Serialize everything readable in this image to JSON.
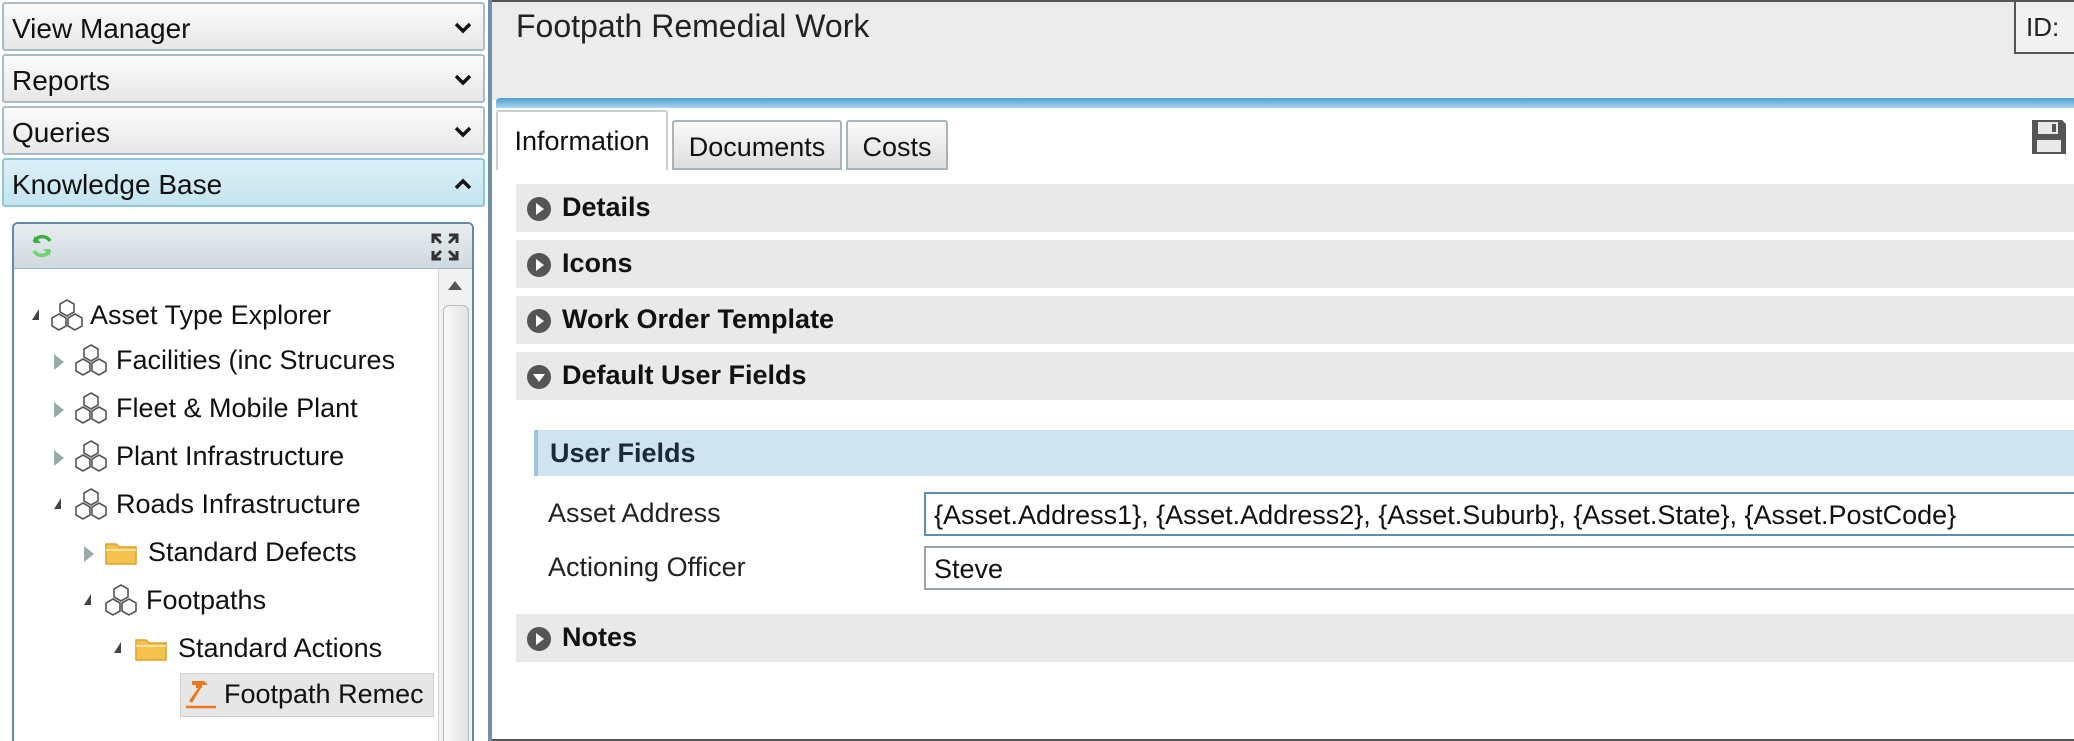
{
  "sidebar": {
    "accordion": {
      "view_manager": "View Manager",
      "reports": "Reports",
      "queries": "Queries",
      "knowledge_base": "Knowledge Base"
    },
    "tree": {
      "items": [
        {
          "label": "Asset Type Explorer",
          "icon": "cubes-icon",
          "state": "expanded"
        },
        {
          "label": "Facilities (inc Strucures",
          "icon": "cubes-icon",
          "state": "collapsed"
        },
        {
          "label": "Fleet & Mobile Plant",
          "icon": "cubes-icon",
          "state": "collapsed"
        },
        {
          "label": "Plant Infrastructure",
          "icon": "cubes-icon",
          "state": "collapsed"
        },
        {
          "label": "Roads Infrastructure",
          "icon": "cubes-icon",
          "state": "expanded"
        },
        {
          "label": "Standard Defects",
          "icon": "folder-icon",
          "state": "collapsed"
        },
        {
          "label": "Footpaths",
          "icon": "cubes-icon",
          "state": "expanded"
        },
        {
          "label": "Standard Actions",
          "icon": "folder-icon",
          "state": "expanded"
        },
        {
          "label": "Footpath Remec",
          "icon": "hammer-icon",
          "state": "selected"
        }
      ]
    }
  },
  "main": {
    "title": "Footpath Remedial Work",
    "id_label": "ID:",
    "tabs": [
      {
        "label": "Information",
        "active": true
      },
      {
        "label": "Documents",
        "active": false
      },
      {
        "label": "Costs",
        "active": false
      }
    ],
    "sections": {
      "details": "Details",
      "icons": "Icons",
      "work_order_template": "Work Order Template",
      "default_user_fields": "Default User Fields",
      "notes": "Notes"
    },
    "user_fields": {
      "header": "User Fields",
      "asset_address_label": "Asset Address",
      "asset_address_value": "{Asset.Address1},  {Asset.Address2},  {Asset.Suburb},  {Asset.State},  {Asset.PostCode}",
      "actioning_officer_label": "Actioning Officer",
      "actioning_officer_value": "Steve"
    }
  },
  "colors": {
    "accent_blue": "#4a9fd0",
    "active_accordion": "#c4e4ef",
    "folder": "#f4c24d",
    "hammer": "#e8791e"
  }
}
